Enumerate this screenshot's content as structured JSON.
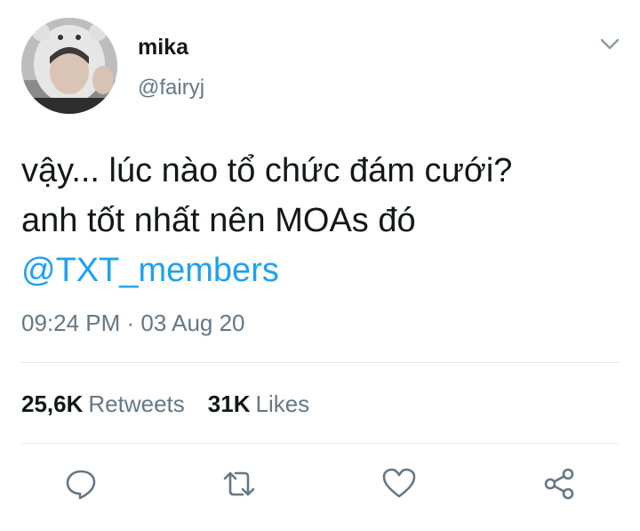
{
  "author": {
    "name": "mika",
    "handle": "@fairyj"
  },
  "tweet": {
    "line1": "vậy... lúc nào tổ chức đám cưới?",
    "line2": "anh tốt nhất nên MOAs đó",
    "mention": "@TXT_members",
    "timestamp": "09:24 PM · 03 Aug 20"
  },
  "stats": {
    "retweets_count": "25,6K",
    "retweets_label": "Retweets",
    "likes_count": "31K",
    "likes_label": "Likes"
  },
  "actions": {
    "reply_icon": "reply-icon",
    "retweet_icon": "retweet-icon",
    "like_icon": "heart-icon",
    "share_icon": "share-icon"
  },
  "colors": {
    "text": "#14171a",
    "secondary": "#657786",
    "link": "#1da1f2",
    "divider": "#e1e8ed"
  }
}
